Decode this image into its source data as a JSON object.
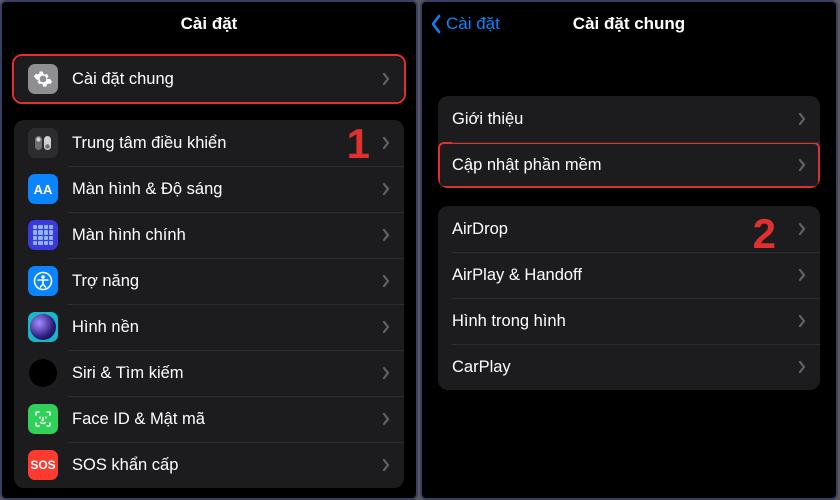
{
  "left": {
    "title": "Cài đặt",
    "annot": "1",
    "rows": [
      {
        "label": "Cài đặt chung",
        "icon": "general",
        "name": "row-general",
        "highlight": true
      },
      {
        "label": "Trung tâm điều khiển",
        "icon": "control",
        "name": "row-control-center"
      },
      {
        "label": "Màn hình & Độ sáng",
        "icon": "display",
        "name": "row-display"
      },
      {
        "label": "Màn hình chính",
        "icon": "home",
        "name": "row-home-screen"
      },
      {
        "label": "Trợ năng",
        "icon": "access",
        "name": "row-accessibility"
      },
      {
        "label": "Hình nền",
        "icon": "wall",
        "name": "row-wallpaper"
      },
      {
        "label": "Siri & Tìm kiếm",
        "icon": "siri",
        "name": "row-siri"
      },
      {
        "label": "Face ID & Mật mã",
        "icon": "face",
        "name": "row-faceid"
      },
      {
        "label": "SOS khẩn cấp",
        "icon": "sos",
        "name": "row-sos"
      }
    ]
  },
  "right": {
    "back": "Cài đặt",
    "title": "Cài đặt chung",
    "annot": "2",
    "groups": [
      [
        {
          "label": "Giới thiệu",
          "name": "row-about"
        },
        {
          "label": "Cập nhật phần mềm",
          "name": "row-software-update",
          "highlight": true
        }
      ],
      [
        {
          "label": "AirDrop",
          "name": "row-airdrop"
        },
        {
          "label": "AirPlay & Handoff",
          "name": "row-airplay"
        },
        {
          "label": "Hình trong hình",
          "name": "row-pip"
        },
        {
          "label": "CarPlay",
          "name": "row-carplay"
        }
      ]
    ]
  }
}
